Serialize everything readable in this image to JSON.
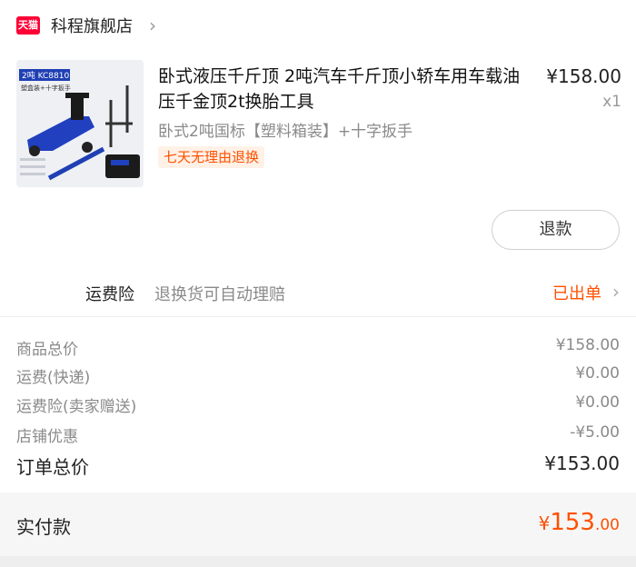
{
  "shop": {
    "logo_text": "天猫",
    "name": "科程旗舰店",
    "chevron": "›"
  },
  "product": {
    "title": "卧式液压千斤顶 2吨汽车千斤顶小轿车用车载油压千金顶2t换胎工具",
    "price": "¥158.00",
    "quantity": "x1",
    "sku": "卧式2吨国标【塑料箱装】+十字扳手",
    "return_tag": "七天无理由退换",
    "image": {
      "model_badge": "2吨 KC8810",
      "caption": "塑盒装+十字扳手"
    }
  },
  "actions": {
    "refund_label": "退款"
  },
  "insurance": {
    "label": "运费险",
    "description": "退换货可自动理赔",
    "status": "已出单",
    "chevron": "›"
  },
  "summary": {
    "rows": [
      {
        "label": "商品总价",
        "value": "¥158.00"
      },
      {
        "label": "运费(快递)",
        "value": "¥0.00"
      },
      {
        "label": "运费险(卖家赠送)",
        "value": "¥0.00"
      },
      {
        "label": "店铺优惠",
        "value": "-¥5.00"
      }
    ],
    "total_label": "订单总价",
    "total_value": "¥153.00"
  },
  "paid": {
    "label": "实付款",
    "currency": "¥",
    "integer": "153",
    "decimal": ".00"
  },
  "colors": {
    "accent": "#ff5000",
    "tmall_red": "#ff0036",
    "product_blue": "#1f3fb3"
  }
}
